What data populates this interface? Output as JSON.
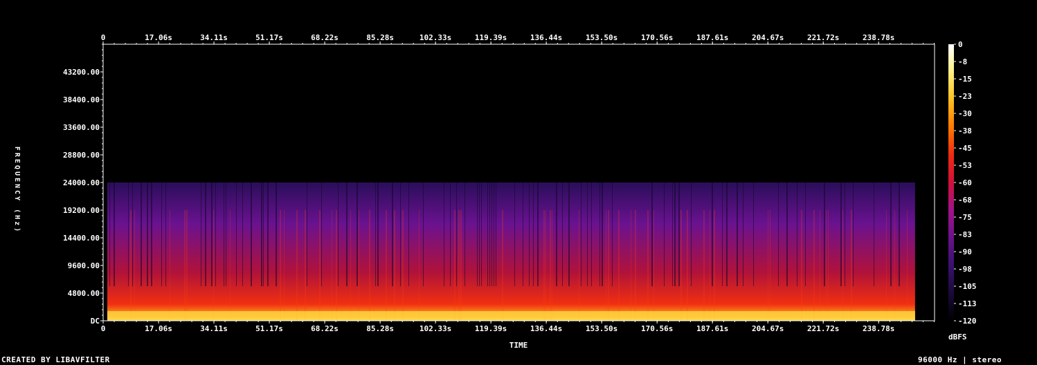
{
  "chart_data": {
    "type": "heatmap",
    "title": "",
    "xlabel": "TIME",
    "ylabel": "FREQUENCY (Hz)",
    "x_ticks": [
      "0",
      "17.06s",
      "34.11s",
      "51.17s",
      "68.22s",
      "85.28s",
      "102.33s",
      "119.39s",
      "136.44s",
      "153.50s",
      "170.56s",
      "187.61s",
      "204.67s",
      "221.72s",
      "238.78s"
    ],
    "x_tick_values": [
      0,
      17.06,
      34.11,
      51.17,
      68.22,
      85.28,
      102.33,
      119.39,
      136.44,
      153.5,
      170.56,
      187.61,
      204.67,
      221.72,
      238.78
    ],
    "xlim": [
      0,
      256
    ],
    "y_ticks": [
      "DC",
      "4800.00",
      "9600.00",
      "14400.00",
      "19200.00",
      "24000.00",
      "28800.00",
      "33600.00",
      "38400.00",
      "43200.00"
    ],
    "y_tick_values": [
      0,
      4800,
      9600,
      14400,
      19200,
      24000,
      28800,
      33600,
      38400,
      43200
    ],
    "ylim": [
      0,
      48000
    ],
    "content_upper_frequency_hz": 24000,
    "audio_duration_s": 250,
    "colorbar": {
      "label": "dBFS",
      "ticks": [
        "0",
        "-8",
        "-15",
        "-23",
        "-30",
        "-38",
        "-45",
        "-53",
        "-60",
        "-68",
        "-75",
        "-83",
        "-90",
        "-98",
        "-105",
        "-113",
        "-120"
      ],
      "range": [
        -120,
        0
      ],
      "gradient": [
        "#000000",
        "#1a0a3a",
        "#3a1070",
        "#6a128a",
        "#a0128a",
        "#d0103a",
        "#f02a10",
        "#ff7a00",
        "#ffc020",
        "#fff080",
        "#ffffff"
      ]
    },
    "grid": false
  },
  "footer": {
    "left": "CREATED BY LIBAVFILTER",
    "right": "96000 Hz | stereo"
  }
}
